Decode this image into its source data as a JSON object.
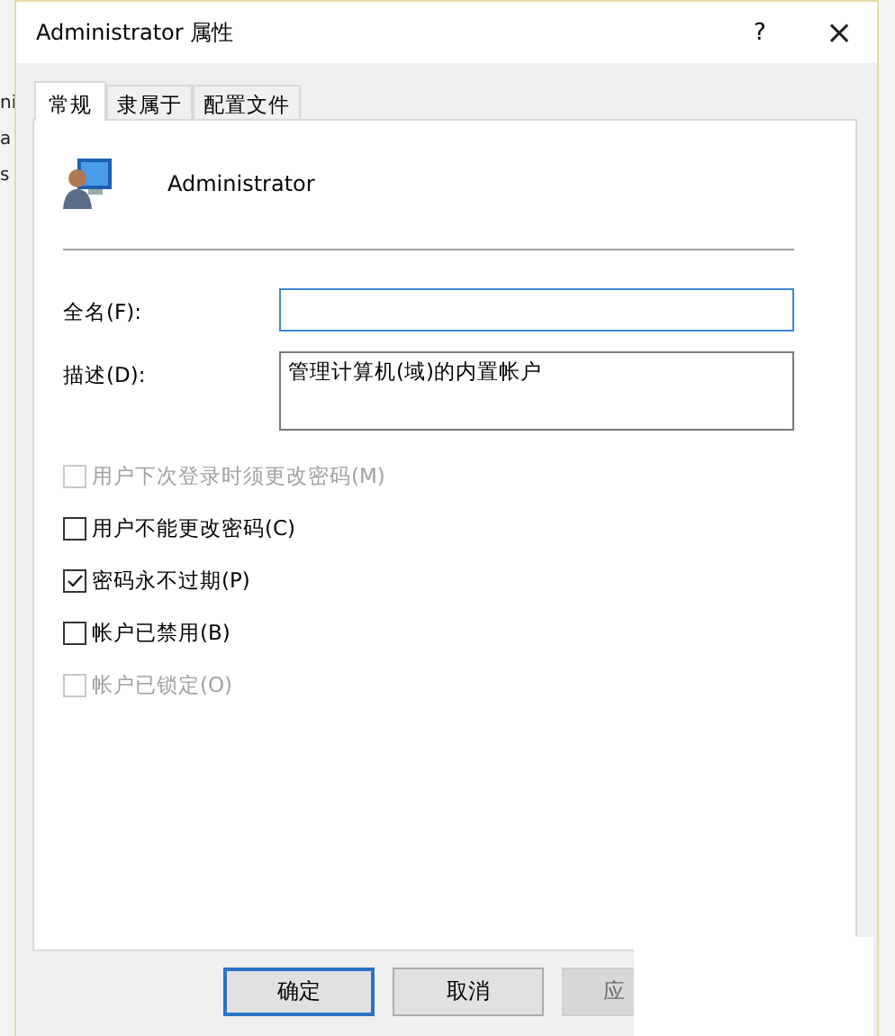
{
  "background_window": {
    "lines": [
      "ni",
      "a",
      "s"
    ]
  },
  "window": {
    "title": "Administrator 属性",
    "help": "?",
    "close": "×"
  },
  "tabs": [
    {
      "label": "常规",
      "selected": true
    },
    {
      "label": "隶属于",
      "selected": false
    },
    {
      "label": "配置文件",
      "selected": false
    }
  ],
  "user": {
    "name": "Administrator"
  },
  "fields": [
    {
      "label": "全名(F):",
      "focused": true,
      "kind": "line"
    },
    {
      "label": "描述(D):",
      "value": "管理计算机(域)的内置帐户",
      "focused": false,
      "kind": "box"
    }
  ],
  "options": [
    {
      "label": "用户下次登录时须更改密码(M)",
      "checked": false,
      "disabled": true
    },
    {
      "label": "用户不能更改密码(C)",
      "checked": false,
      "disabled": false
    },
    {
      "label": "密码永不过期(P)",
      "checked": true,
      "disabled": false
    },
    {
      "label": "帐户已禁用(B)",
      "checked": false,
      "disabled": false
    },
    {
      "label": "帐户已锁定(O)",
      "checked": false,
      "disabled": true
    }
  ],
  "buttons": [
    {
      "label": "确定",
      "default": true,
      "disabled": false
    },
    {
      "label": "取消",
      "default": false,
      "disabled": false
    },
    {
      "label": "应",
      "default": false,
      "disabled": true
    }
  ]
}
